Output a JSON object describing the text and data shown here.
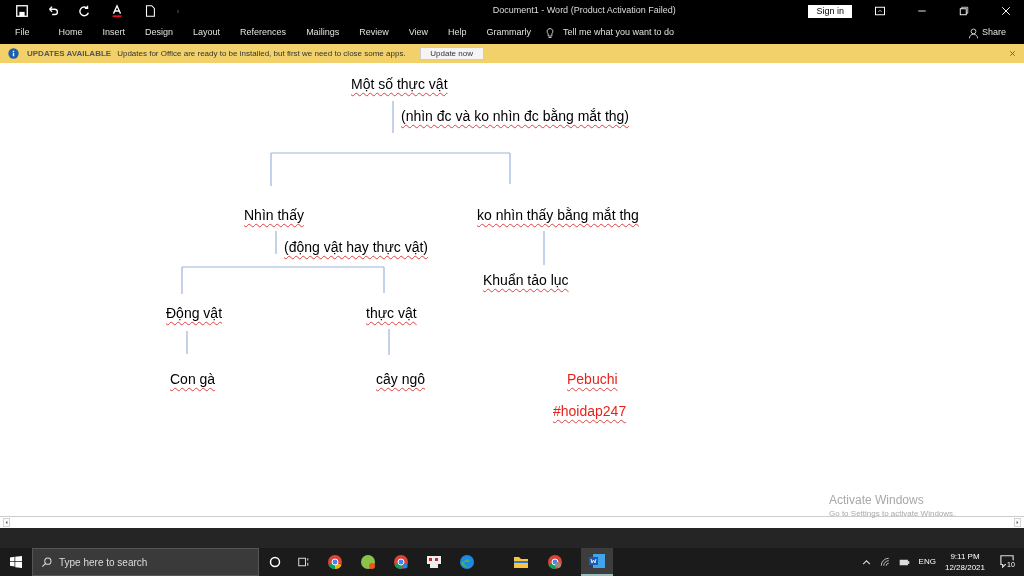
{
  "title_bar": {
    "title": "Document1  -  Word (Product Activation Failed)",
    "sign_in": "Sign in"
  },
  "ribbon_tabs": [
    {
      "label": "File"
    },
    {
      "label": "Home"
    },
    {
      "label": "Insert"
    },
    {
      "label": "Design"
    },
    {
      "label": "Layout"
    },
    {
      "label": "References"
    },
    {
      "label": "Mailings"
    },
    {
      "label": "Review"
    },
    {
      "label": "View"
    },
    {
      "label": "Help"
    },
    {
      "label": "Grammarly"
    }
  ],
  "tell_me": {
    "placeholder": "Tell me what you want to do"
  },
  "share": "Share",
  "update_bar": {
    "heading": "UPDATES AVAILABLE",
    "message": "Updates for Office are ready to be installed, but first we need to close some apps.",
    "button": "Update now"
  },
  "document": {
    "nodes": [
      {
        "text": "Một số thực vật",
        "color": "#000000"
      },
      {
        "text": "(nhìn đc và ko nhìn đc bằng mắt thg)",
        "color": "#000000"
      },
      {
        "text": "Nhìn thấy",
        "color": "#000000"
      },
      {
        "text": "ko nhìn thấy bằng mắt thg",
        "color": "#000000"
      },
      {
        "text": "(động vật hay thực vật)",
        "color": "#000000"
      },
      {
        "text": "Khuẩn tảo lục",
        "color": "#000000"
      },
      {
        "text": "Động vật",
        "color": "#000000"
      },
      {
        "text": "thực vật",
        "color": "#000000"
      },
      {
        "text": "Con gà",
        "color": "#000000"
      },
      {
        "text": "cây ngô",
        "color": "#000000"
      },
      {
        "text": "Pebuchi",
        "color": "#e8221b"
      },
      {
        "text": "#hoidap247",
        "color": "#e8221b"
      }
    ]
  },
  "activation": {
    "title": "Activate Windows",
    "message": "Go to Settings to activate Windows."
  },
  "taskbar": {
    "search": {
      "placeholder": "Type here to search"
    },
    "language": "ENG",
    "time": "9:11 PM",
    "date": "12/28/2021",
    "notifications": "10"
  }
}
